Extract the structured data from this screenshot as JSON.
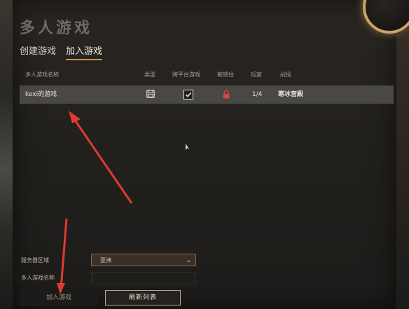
{
  "header": {
    "title": "多人游戏"
  },
  "tabs": [
    {
      "label": "创建游戏",
      "active": false
    },
    {
      "label": "加入游戏",
      "active": true
    }
  ],
  "table": {
    "columns": [
      "多人游戏名称",
      "类型",
      "跨平台游戏",
      "被锁住",
      "玩家",
      "战役"
    ],
    "rows": [
      {
        "name": "kexi的游戏",
        "type_icon": "save-icon",
        "crossplatform": true,
        "locked": true,
        "players": "1/4",
        "campaign": "寒冰宫殿"
      }
    ]
  },
  "footer": {
    "server_region_label": "服务器区域",
    "server_region_value": "亚洲",
    "game_name_label": "多人游戏名称",
    "game_name_value": "",
    "join_button": "加入游戏",
    "refresh_button": "刷新列表"
  },
  "colors": {
    "accent": "#c98e52",
    "row_bg": "#4a4844",
    "lock": "#d9434a",
    "annotation_arrow": "#e23a2e"
  }
}
